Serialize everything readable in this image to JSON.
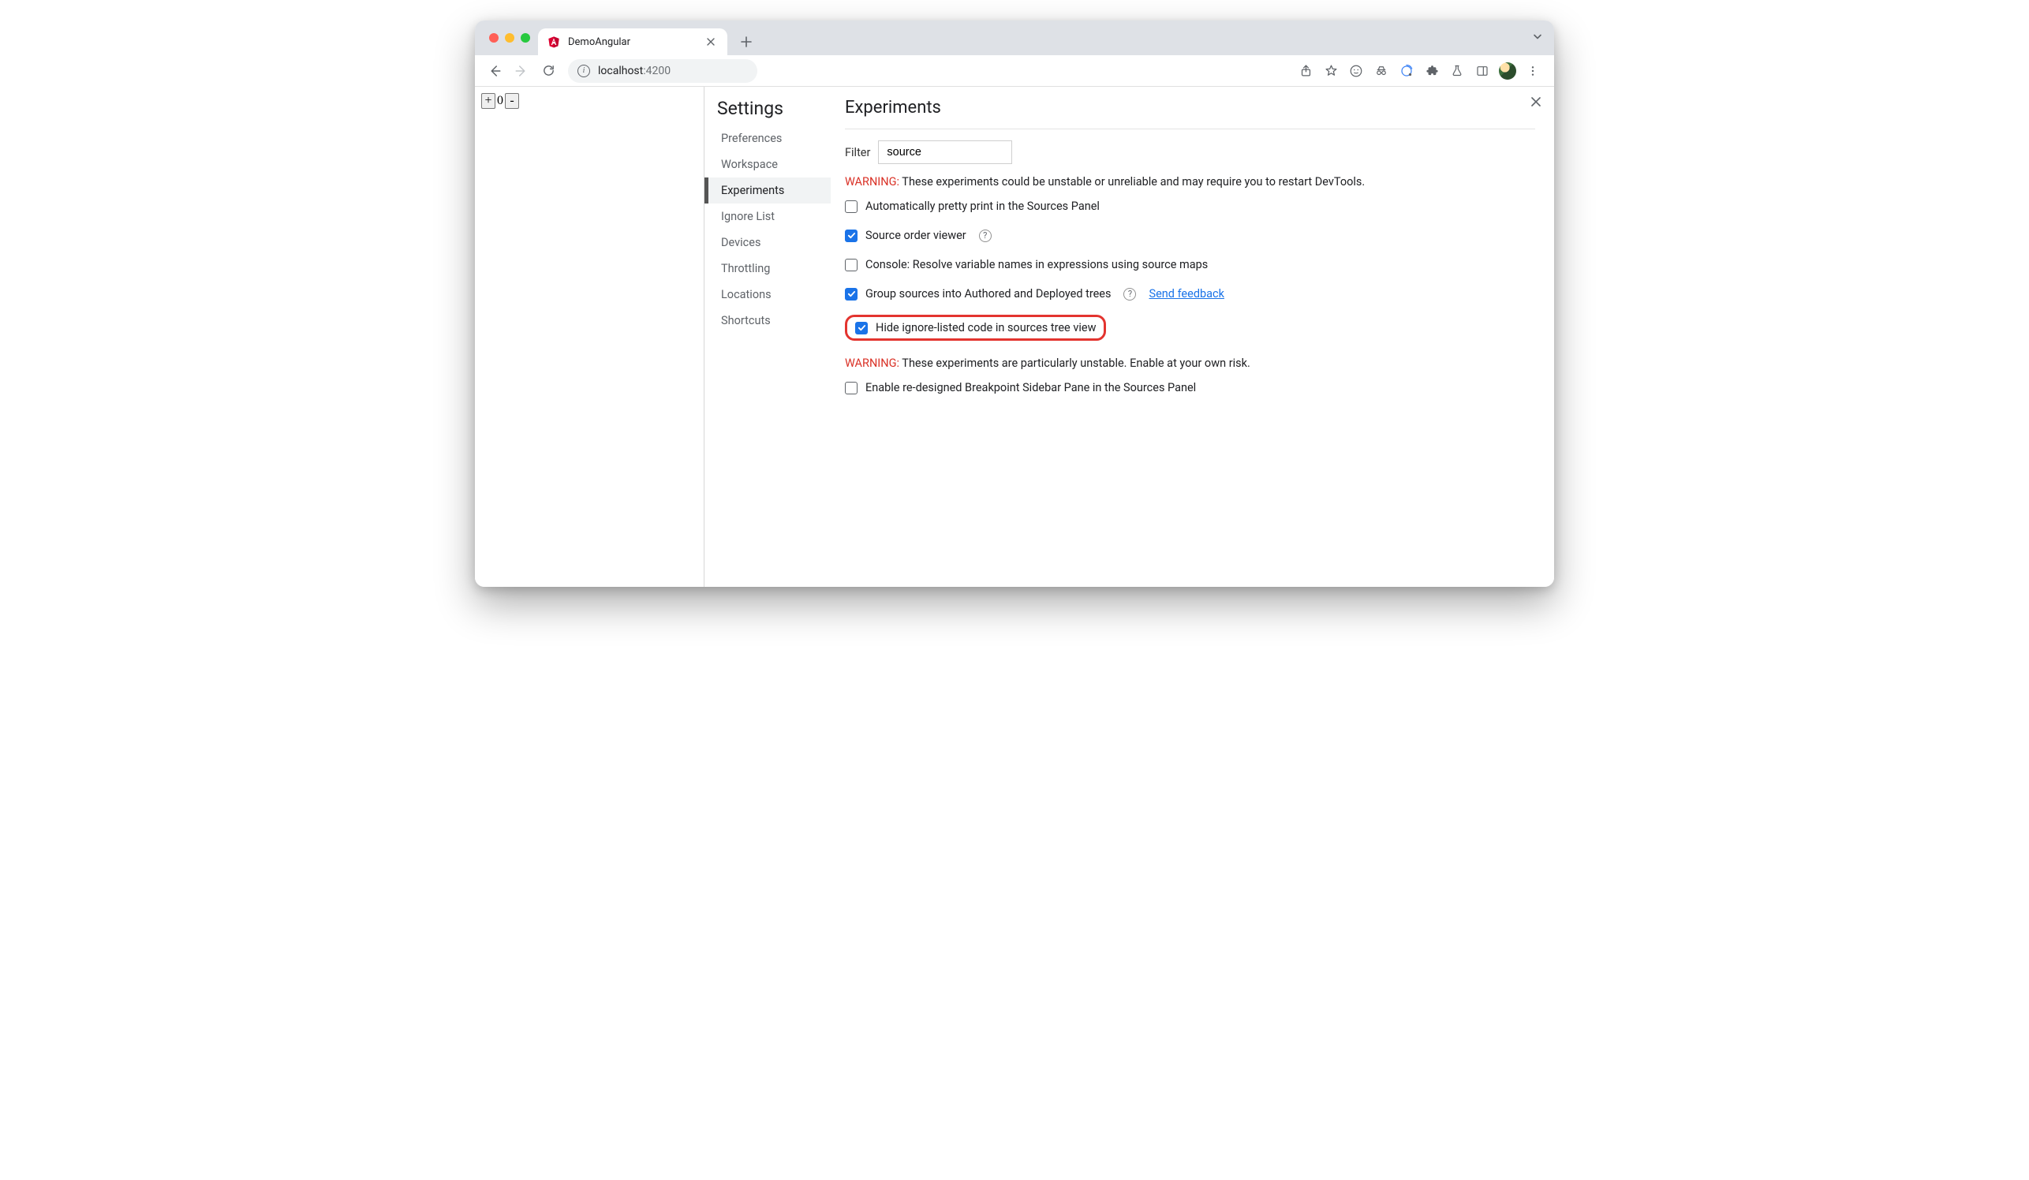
{
  "tab": {
    "title": "DemoAngular"
  },
  "address": {
    "host": "localhost",
    "rest": ":4200"
  },
  "page": {
    "plus": "+",
    "count": "0",
    "minus": "-"
  },
  "settings": {
    "heading": "Settings",
    "nav": {
      "preferences": "Preferences",
      "workspace": "Workspace",
      "experiments": "Experiments",
      "ignore_list": "Ignore List",
      "devices": "Devices",
      "throttling": "Throttling",
      "locations": "Locations",
      "shortcuts": "Shortcuts"
    }
  },
  "experiments": {
    "heading": "Experiments",
    "filter_label": "Filter",
    "filter_value": "source",
    "warning1_prefix": "WARNING:",
    "warning1_text": " These experiments could be unstable or unreliable and may require you to restart DevTools.",
    "items": [
      {
        "label": "Automatically pretty print in the Sources Panel",
        "checked": false,
        "help": false,
        "link": null,
        "highlight": false
      },
      {
        "label": "Source order viewer",
        "checked": true,
        "help": true,
        "link": null,
        "highlight": false
      },
      {
        "label": "Console: Resolve variable names in expressions using source maps",
        "checked": false,
        "help": false,
        "link": null,
        "highlight": false
      },
      {
        "label": "Group sources into Authored and Deployed trees",
        "checked": true,
        "help": true,
        "link": "Send feedback",
        "highlight": false
      },
      {
        "label": "Hide ignore-listed code in sources tree view",
        "checked": true,
        "help": false,
        "link": null,
        "highlight": true
      }
    ],
    "warning2_prefix": "WARNING:",
    "warning2_text": " These experiments are particularly unstable. Enable at your own risk.",
    "items2": [
      {
        "label": "Enable re-designed Breakpoint Sidebar Pane in the Sources Panel",
        "checked": false
      }
    ]
  }
}
